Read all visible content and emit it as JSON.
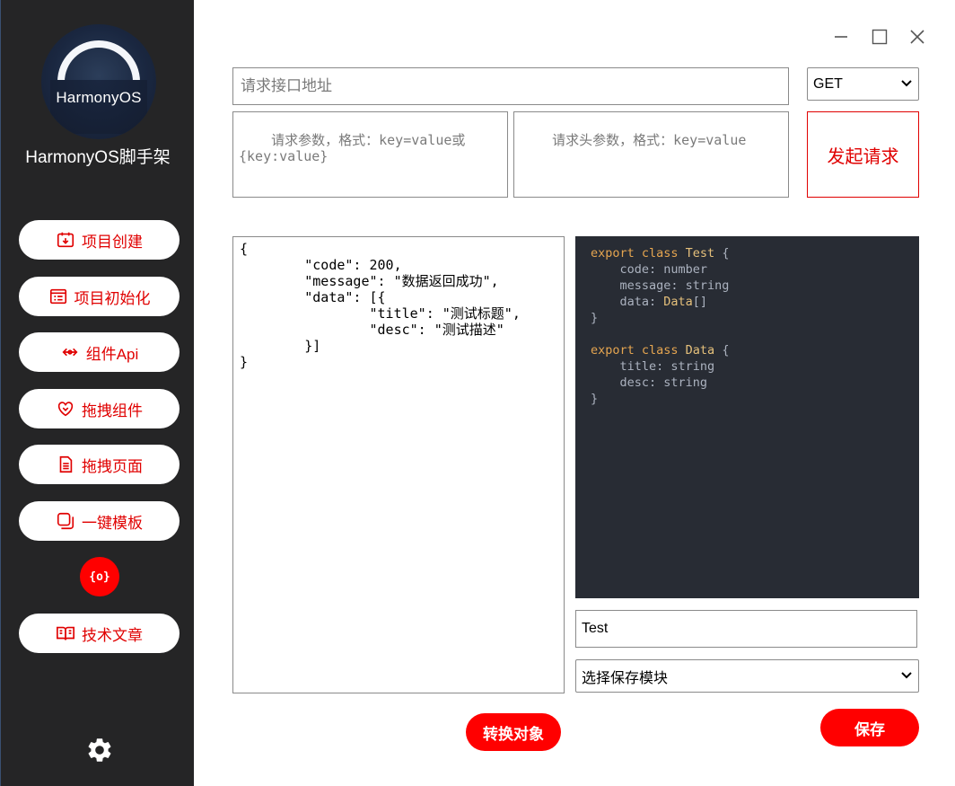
{
  "sidebar": {
    "logo_text": "HarmonyOS",
    "app_name": "HarmonyOS脚手架",
    "items": [
      {
        "label": "项目创建",
        "icon": "project-create-icon"
      },
      {
        "label": "项目初始化",
        "icon": "project-init-icon"
      },
      {
        "label": "组件Api",
        "icon": "component-api-icon"
      },
      {
        "label": "拖拽组件",
        "icon": "drag-component-icon"
      },
      {
        "label": "拖拽页面",
        "icon": "drag-page-icon"
      },
      {
        "label": "一键模板",
        "icon": "template-icon"
      }
    ],
    "api_dot_label": "{o}",
    "article_label": "技术文章",
    "settings_icon": "gear-icon"
  },
  "window": {
    "minimize_icon": "minimize-icon",
    "maximize_icon": "maximize-icon",
    "close_icon": "close-icon"
  },
  "request": {
    "url_placeholder": "请求接口地址",
    "method": "GET",
    "params_placeholder": "请求参数，格式：key=value或{key:value}",
    "headers_placeholder": "请求头参数，格式：key=value",
    "send_label": "发起请求"
  },
  "json_input": "{\n        \"code\": 200,\n        \"message\": \"数据返回成功\",\n        \"data\": [{\n                \"title\": \"测试标题\",\n                \"desc\": \"测试描述\"\n        }]\n}",
  "code_output": {
    "lines": [
      [
        {
          "t": "export class ",
          "c": "kw"
        },
        {
          "t": "Test",
          "c": "cls"
        },
        {
          "t": " {",
          "c": ""
        }
      ],
      [
        {
          "t": "    code: number",
          "c": ""
        }
      ],
      [
        {
          "t": "    message: string",
          "c": ""
        }
      ],
      [
        {
          "t": "    data: ",
          "c": ""
        },
        {
          "t": "Data",
          "c": "typ"
        },
        {
          "t": "[]",
          "c": ""
        }
      ],
      [
        {
          "t": "}",
          "c": ""
        }
      ],
      [
        {
          "t": "",
          "c": ""
        }
      ],
      [
        {
          "t": "export class ",
          "c": "kw"
        },
        {
          "t": "Data",
          "c": "cls"
        },
        {
          "t": " {",
          "c": ""
        }
      ],
      [
        {
          "t": "    title: string",
          "c": ""
        }
      ],
      [
        {
          "t": "    desc: string",
          "c": ""
        }
      ],
      [
        {
          "t": "}",
          "c": ""
        }
      ]
    ]
  },
  "class_name_value": "Test",
  "module_select_value": "选择保存模块",
  "convert_label": "转换对象",
  "save_label": "保存",
  "colors": {
    "accent": "#ff0000",
    "sidebar_bg": "#252526",
    "code_bg": "#282c34"
  }
}
